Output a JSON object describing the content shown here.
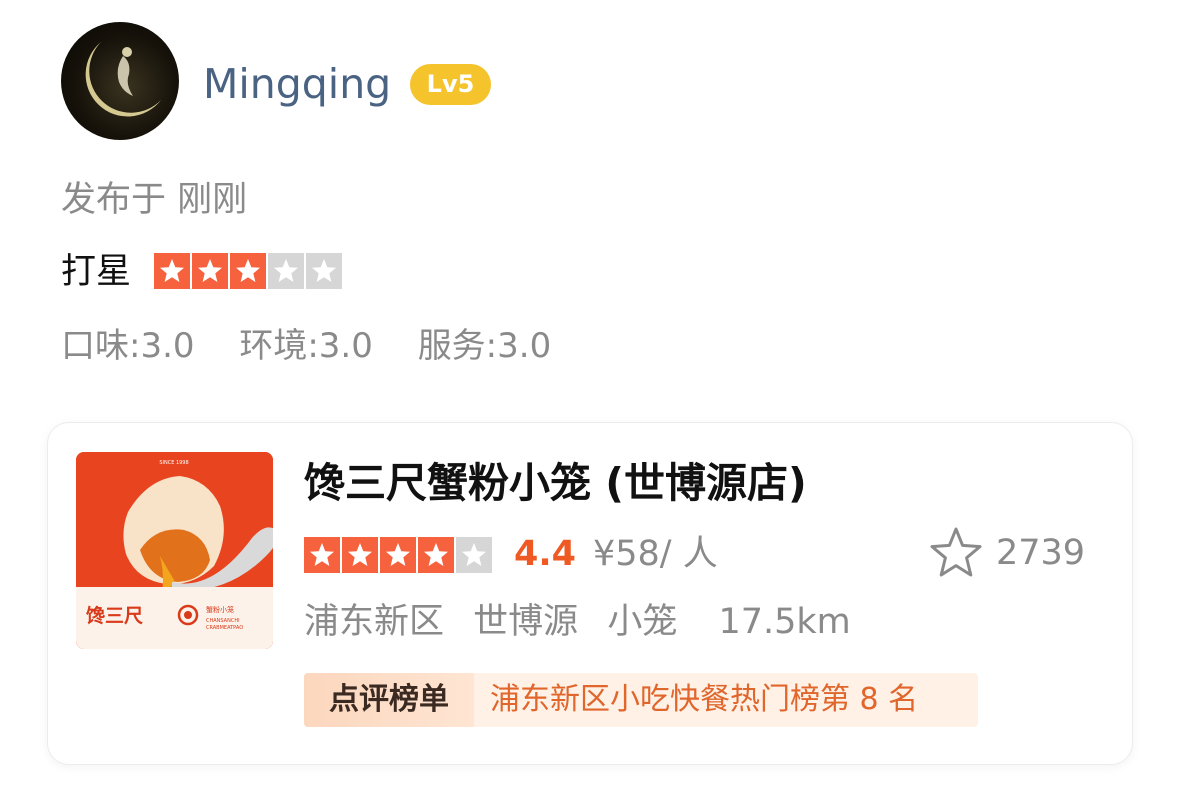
{
  "user": {
    "name": "Mingqing",
    "level": "Lv5"
  },
  "post": {
    "published": "发布于 刚刚",
    "rating_label": "打星",
    "rating": 3,
    "rating_max": 5,
    "subscores": [
      "口味:3.0",
      "环境:3.0",
      "服务:3.0"
    ]
  },
  "shop": {
    "name": "馋三尺蟹粉小笼 (世博源店)",
    "stars": 4,
    "stars_max": 5,
    "score": "4.4",
    "price": "¥58/ 人",
    "favorites": "2739",
    "district": "浦东新区",
    "area": "世博源",
    "category": "小笼",
    "distance": "17.5km",
    "rank_tag": "点评榜单",
    "rank_text": "浦东新区小吃快餐热门榜第 8 名",
    "image_caption": {
      "since": "SINCE 1998",
      "brand": "馋三尺",
      "subbrand": "蟹粉小笼",
      "english1": "CHANSANCHI",
      "english2": "CRABMEATPAO"
    }
  },
  "colors": {
    "star_on": "#f6623d",
    "star_off": "#d6d6d6",
    "accent": "#ef5a24",
    "badge": "#f5c32b"
  }
}
